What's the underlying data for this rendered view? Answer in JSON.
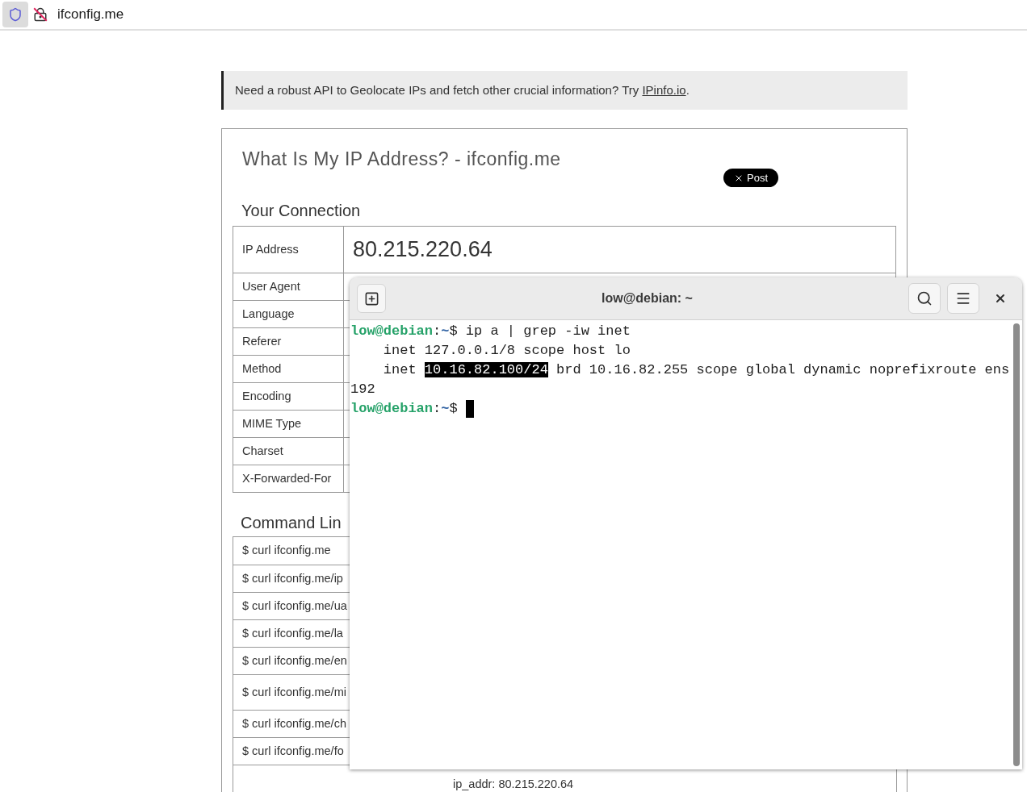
{
  "browser": {
    "address": "ifconfig.me"
  },
  "banner": {
    "text": "Need a robust API to Geolocate IPs and fetch other crucial information? Try ",
    "link": "IPinfo.io",
    "after": "."
  },
  "page": {
    "title": "What Is My IP Address? - ifconfig.me",
    "share_button": "Post"
  },
  "connection": {
    "heading": "Your Connection",
    "rows": [
      {
        "label": "IP Address",
        "value": "80.215.220.64"
      },
      {
        "label": "User Agent"
      },
      {
        "label": "Language"
      },
      {
        "label": "Referer"
      },
      {
        "label": "Method"
      },
      {
        "label": "Encoding"
      },
      {
        "label": "MIME Type"
      },
      {
        "label": "Charset"
      },
      {
        "label": "X-Forwarded-For"
      }
    ]
  },
  "command_line": {
    "heading": "Command Lin",
    "rows": [
      {
        "command": "$ curl ifconfig.me",
        "tall": false
      },
      {
        "command": "$ curl ifconfig.me/ip",
        "tall": false
      },
      {
        "command": "$ curl ifconfig.me/ua",
        "tall": false
      },
      {
        "command": "$ curl ifconfig.me/la",
        "tall": false
      },
      {
        "command": "$ curl ifconfig.me/en",
        "tall": false
      },
      {
        "command": "$ curl ifconfig.me/mi",
        "tall": true
      },
      {
        "command": "$ curl ifconfig.me/ch",
        "tall": false
      },
      {
        "command": "$ curl ifconfig.me/fo",
        "tall": false
      }
    ],
    "output": "ip_addr: 80.215.220.64"
  },
  "terminal": {
    "title": "low@debian: ~",
    "lines": [
      {
        "kind": "prompt",
        "user": "low@debian",
        "sep": ":",
        "path": "~",
        "symbol": "$",
        "command": " ip a | grep -iw inet",
        "cursor": false
      },
      {
        "kind": "output",
        "text": "    inet 127.0.0.1/8 scope host lo"
      },
      {
        "kind": "selection",
        "before": "    inet ",
        "selected": "10.16.82.100/24",
        "after": " brd 10.16.82.255 scope global dynamic noprefixroute ens"
      },
      {
        "kind": "output",
        "text": "192"
      },
      {
        "kind": "prompt",
        "user": "low@debian",
        "sep": ":",
        "path": "~",
        "symbol": "$",
        "cursor": true
      }
    ]
  }
}
